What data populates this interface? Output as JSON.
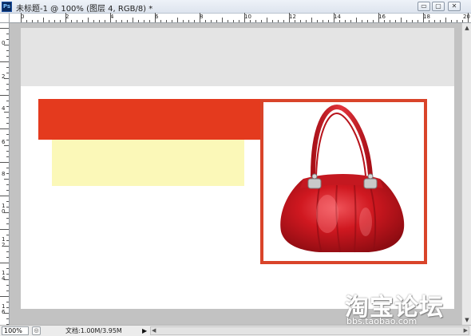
{
  "window": {
    "app_icon": "Ps",
    "title": "未标题-1 @ 100% (图层 4, RGB/8) *",
    "buttons": {
      "minimize": "▭",
      "maximize": "▢",
      "close": "✕"
    }
  },
  "rulers": {
    "top_labels": [
      "0",
      "2",
      "4",
      "6",
      "8",
      "10",
      "12",
      "14",
      "16",
      "18",
      "20"
    ],
    "left_labels": [
      "0",
      "2",
      "4",
      "6",
      "8",
      "10",
      "12",
      "14",
      "16"
    ]
  },
  "status": {
    "zoom": "100%",
    "doc_info": "文档:1.00M/3.95M",
    "arrow": "▶"
  },
  "watermark": {
    "brand": "淘宝论坛",
    "url": "bbs.taobao.com"
  },
  "colors": {
    "red_bar": "#e43a1e",
    "yellow_rect": "#fbf8b8",
    "frame": "#d9442a",
    "bag": "#d01820"
  }
}
